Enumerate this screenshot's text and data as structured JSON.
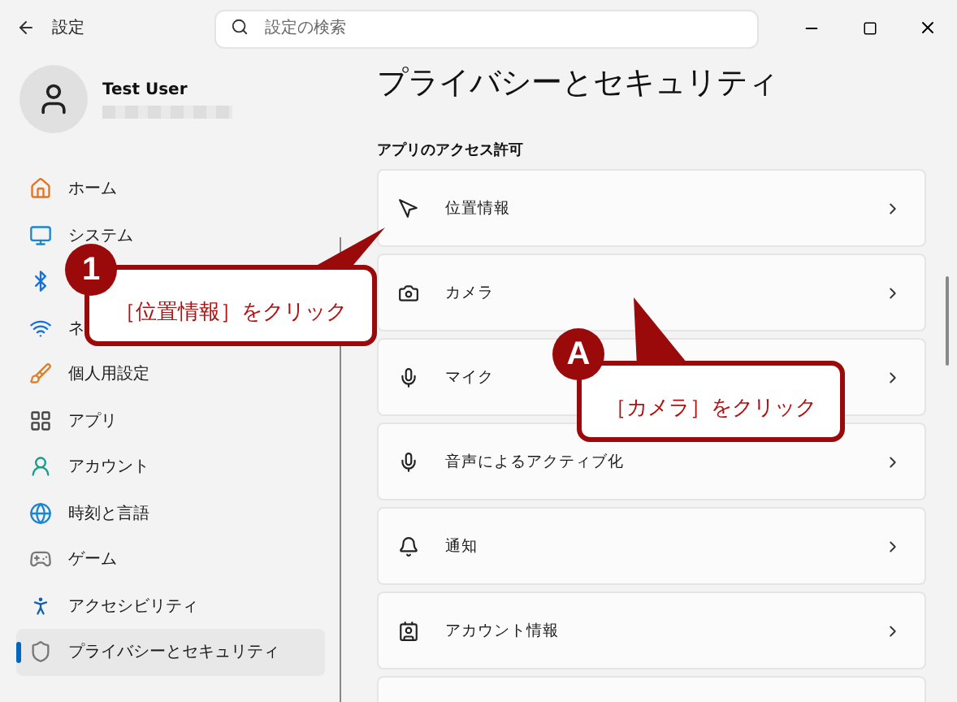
{
  "window": {
    "title": "設定"
  },
  "search": {
    "placeholder": "設定の検索"
  },
  "user": {
    "name": "Test User"
  },
  "sidebar": {
    "items": [
      {
        "label": "ホーム",
        "selected": false
      },
      {
        "label": "システム",
        "selected": false
      },
      {
        "selected": false
      },
      {
        "label": "ネ",
        "selected": false
      },
      {
        "label": "個人用設定",
        "selected": false
      },
      {
        "label": "アプリ",
        "selected": false
      },
      {
        "label": "アカウント",
        "selected": false
      },
      {
        "label": "時刻と言語",
        "selected": false
      },
      {
        "label": "ゲーム",
        "selected": false
      },
      {
        "label": "アクセシビリティ",
        "selected": false
      },
      {
        "label": "プライバシーとセキュリティ",
        "selected": true
      }
    ]
  },
  "page": {
    "title": "プライバシーとセキュリティ",
    "section": "アプリのアクセス許可",
    "items": [
      {
        "label": "位置情報"
      },
      {
        "label": "カメラ"
      },
      {
        "label": "マイク"
      },
      {
        "label": "音声によるアクティブ化"
      },
      {
        "label": "通知"
      },
      {
        "label": "アカウント情報"
      }
    ]
  },
  "callouts": [
    {
      "badge": "1",
      "text": "［位置情報］をクリック"
    },
    {
      "badge": "A",
      "text": "［カメラ］をクリック"
    }
  ]
}
